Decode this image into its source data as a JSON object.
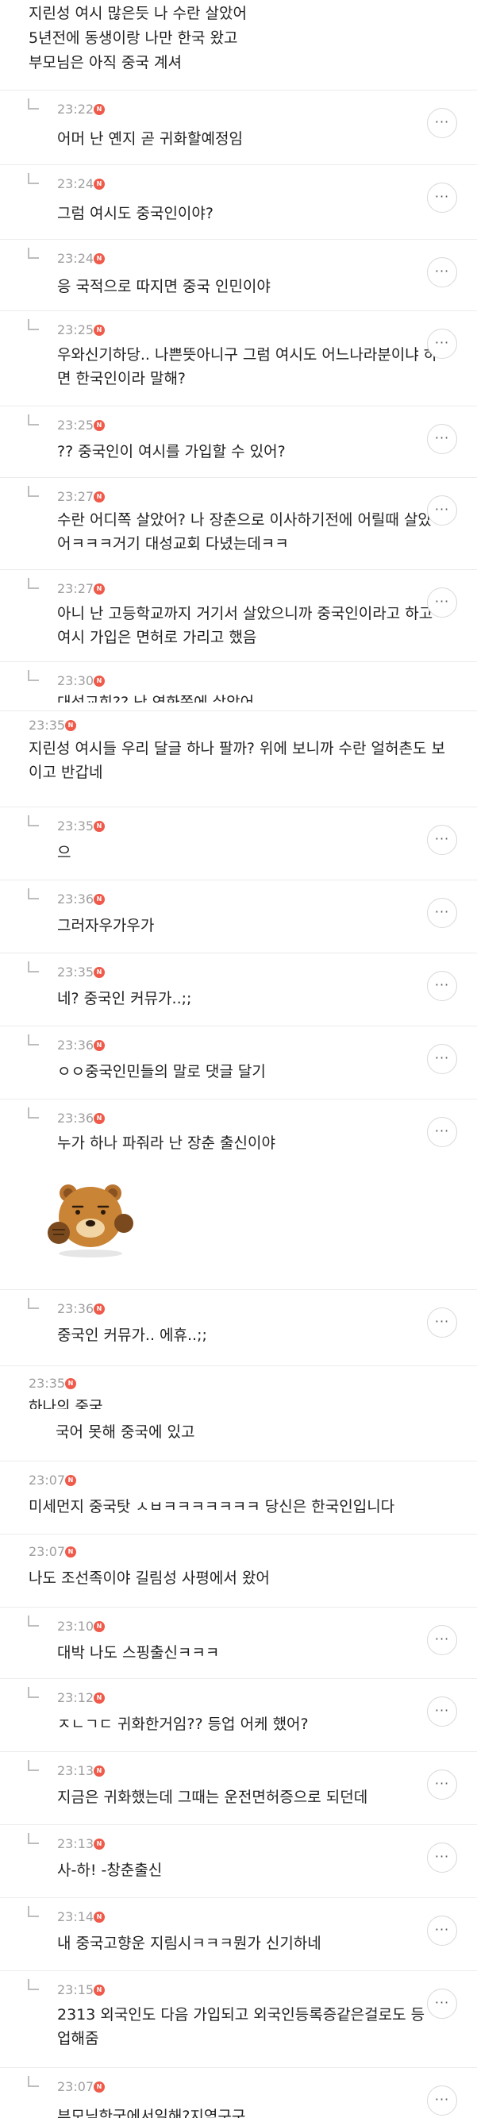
{
  "comments": [
    {
      "reply": false,
      "time": "",
      "lines": [
        "지린성 여시 많은듯 나 수란 살았어",
        "5년전에 동생이랑 나만 한국 왔고",
        "부모님은 아직 중국 계셔"
      ]
    },
    {
      "reply": true,
      "time": "23:22",
      "lines": [
        "어머 난 옌지 곧 귀화할예정임"
      ]
    },
    {
      "reply": true,
      "time": "23:24",
      "lines": [
        "그럼 여시도 중국인이야?"
      ]
    },
    {
      "reply": true,
      "time": "23:24",
      "lines": [
        "응 국적으로 따지면 중국 인민이야"
      ]
    },
    {
      "reply": true,
      "time": "23:25",
      "lines": [
        "우와신기하당.. 나쁜뜻아니구 그럼 여시도 어느나라분이냐 하",
        "면 한국인이라 말해?"
      ]
    },
    {
      "reply": true,
      "time": "23:25",
      "lines": [
        "?? 중국인이 여시를 가입할 수 있어?"
      ]
    },
    {
      "reply": true,
      "time": "23:27",
      "lines": [
        "수란 어디쪽 살았어? 나 장춘으로 이사하기전에 어릴때 살았",
        "어ㅋㅋㅋ거기 대성교회 다녔는데ㅋㅋ"
      ]
    },
    {
      "reply": true,
      "time": "23:27",
      "lines": [
        "아니 난 고등학교까지 거기서 살았으니까 중국인이라고 하고",
        "여시 가입은 면허로 가리고 했음"
      ]
    },
    {
      "reply": true,
      "time": "23:30",
      "lines": [
        "대성교회?? 난 연화쪽에 살았어"
      ]
    },
    {
      "reply": false,
      "time": "23:35",
      "lines": [
        "지린성 여시들 우리 달글 하나 팔까? 위에 보니까 수란 얼허촌도 보",
        "이고 반갑네"
      ]
    },
    {
      "reply": true,
      "time": "23:35",
      "lines": [
        "으"
      ]
    },
    {
      "reply": true,
      "time": "23:36",
      "lines": [
        "그러자우가우가"
      ]
    },
    {
      "reply": true,
      "time": "23:35",
      "lines": [
        "네? 중국인 커뮤가..;;"
      ]
    },
    {
      "reply": true,
      "time": "23:36",
      "lines": [
        "ㅇㅇ중국인민들의 말로 댓글 달기"
      ]
    },
    {
      "reply": true,
      "time": "23:36",
      "lines": [
        "누가 하나 파줘라 난 장춘 출신이야"
      ],
      "sticker": "bear-sticker"
    },
    {
      "reply": true,
      "time": "23:36",
      "lines": [
        "중국인 커뮤가.. 에휴..;;"
      ]
    },
    {
      "reply": false,
      "time": "23:35",
      "lines": [
        "하나의 중국",
        "국어 못해 중국에 있고"
      ]
    },
    {
      "reply": false,
      "time": "23:07",
      "lines": [
        "미세먼지 중국탓 ㅅㅂㅋㅋㅋㅋㅋㅋㅋ 당신은 한국인입니다"
      ]
    },
    {
      "reply": false,
      "time": "23:07",
      "lines": [
        "나도 조선족이야 길림성 사평에서 왔어"
      ]
    },
    {
      "reply": true,
      "time": "23:10",
      "lines": [
        "대박 나도 스핑출신ㅋㅋㅋ"
      ]
    },
    {
      "reply": true,
      "time": "23:12",
      "lines": [
        "ㅈㄴㄱㄷ 귀화한거임?? 등업 어케 했어?"
      ]
    },
    {
      "reply": true,
      "time": "23:13",
      "lines": [
        "지금은 귀화했는데 그때는 운전면허증으로 되던데"
      ]
    },
    {
      "reply": true,
      "time": "23:13",
      "lines": [
        "사-하! -창춘출신"
      ]
    },
    {
      "reply": true,
      "time": "23:14",
      "lines": [
        "내 중국고향운 지림시ㅋㅋㅋ뭔가 신기하네"
      ]
    },
    {
      "reply": true,
      "time": "23:15",
      "lines": [
        "2313  외국인도 다음 가입되고 외국인등록증같은걸로도 등",
        "업해줌"
      ]
    },
    {
      "reply": true,
      "time": "23:07",
      "lines": [
        "부모님한국에서일해?지역구구"
      ]
    }
  ],
  "ui": {
    "new_badge": "N",
    "more_glyph": "···",
    "badge_color": "#ef5a4a"
  }
}
